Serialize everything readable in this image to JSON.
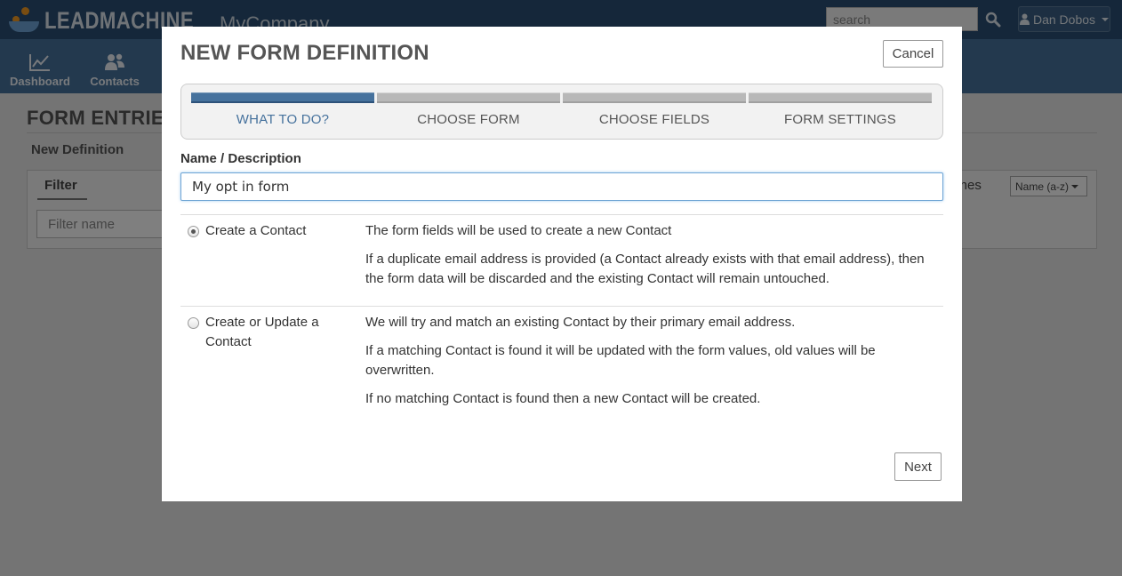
{
  "app": {
    "brand": "LEADMACHINE",
    "company": "MyCompany",
    "search_placeholder": "search",
    "user_name": "Dan Dobos"
  },
  "nav": [
    {
      "label": "Dashboard",
      "icon": "line-chart-icon"
    },
    {
      "label": "Contacts",
      "icon": "users-icon"
    }
  ],
  "page": {
    "heading": "FORM ENTRIE",
    "new_definition": "New Definition",
    "filter_title": "Filter",
    "filter_placeholder": "Filter name",
    "matches_text": "tches",
    "sort_value": "Name (a-z)"
  },
  "modal": {
    "title": "NEW FORM DEFINITION",
    "cancel_label": "Cancel",
    "steps": [
      {
        "label": "WHAT TO DO?",
        "active": true
      },
      {
        "label": "CHOOSE FORM",
        "active": false
      },
      {
        "label": "CHOOSE FIELDS",
        "active": false
      },
      {
        "label": "FORM SETTINGS",
        "active": false
      }
    ],
    "name_label": "Name / Description",
    "name_value": "My opt in form",
    "options": [
      {
        "label": "Create a Contact",
        "checked": true,
        "lines": [
          "The form fields will be used to create a new Contact",
          "If a duplicate email address is provided (a Contact already exists with that email address), then the form data will be discarded and the existing Contact will remain untouched."
        ]
      },
      {
        "label": "Create or Update a Contact",
        "checked": false,
        "lines": [
          "We will try and match an existing Contact by their primary email address.",
          "If a matching Contact is found it will be updated with the form values, old values will be overwritten.",
          "If no matching Contact is found then a new Contact will be created."
        ]
      }
    ],
    "next_label": "Next"
  },
  "colors": {
    "topbar": "#2a4f74",
    "navbar": "#46729d",
    "accent": "#46729d"
  }
}
